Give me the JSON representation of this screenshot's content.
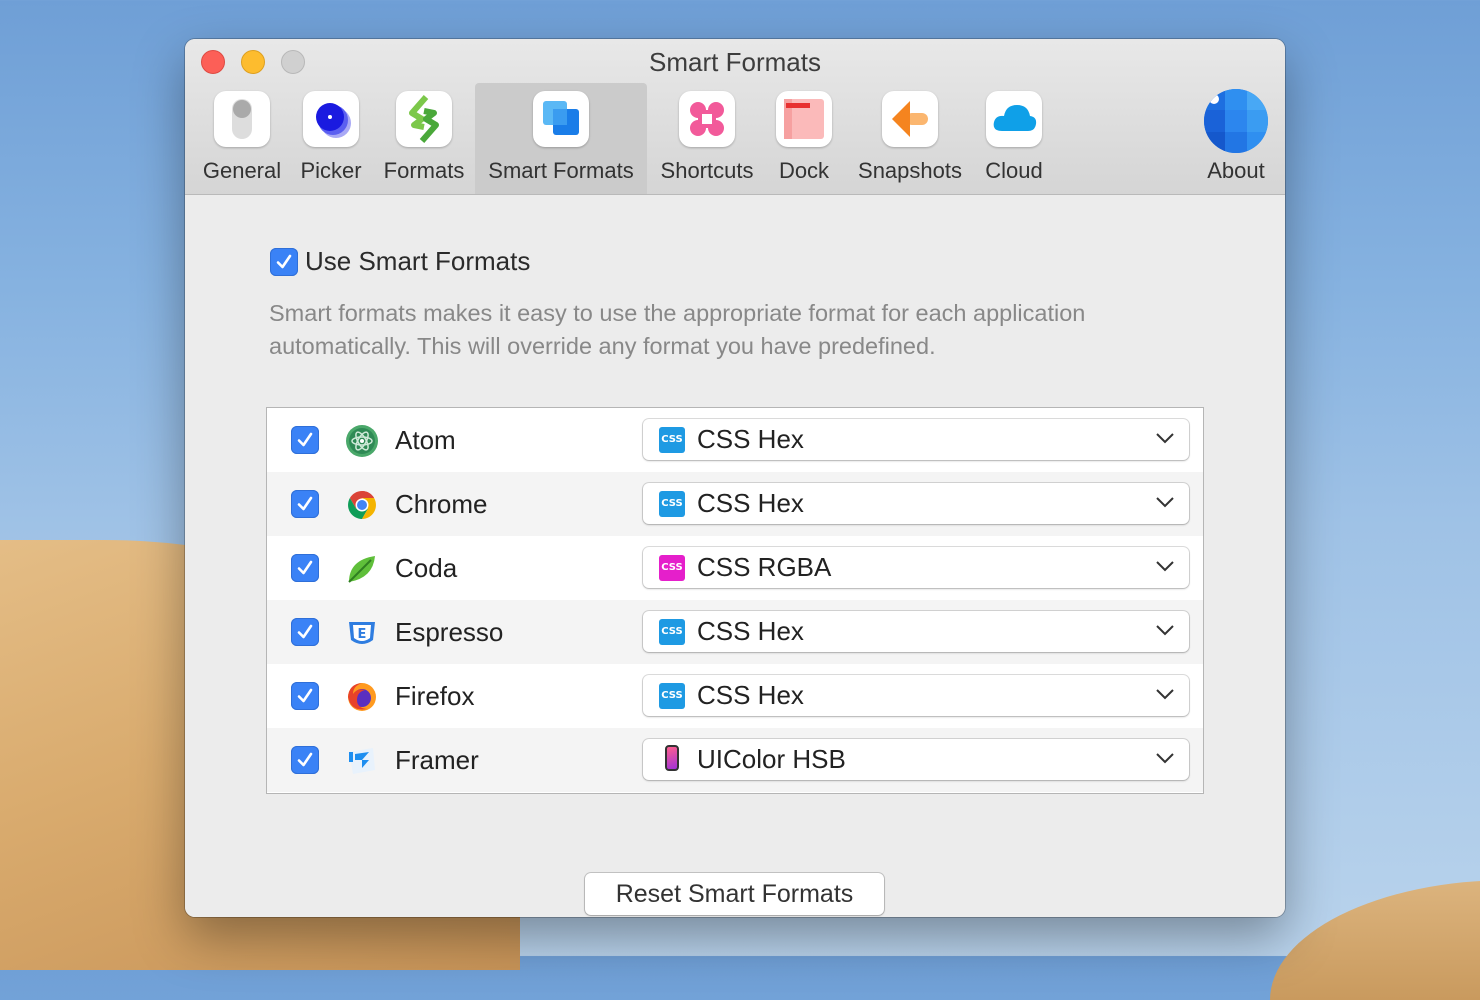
{
  "window": {
    "title": "Smart Formats"
  },
  "toolbar": {
    "tabs": [
      {
        "label": "General",
        "icon": "toggle-icon"
      },
      {
        "label": "Picker",
        "icon": "picker-icon"
      },
      {
        "label": "Formats",
        "icon": "formats-icon"
      },
      {
        "label": "Smart Formats",
        "icon": "smart-formats-icon",
        "active": true
      },
      {
        "label": "Shortcuts",
        "icon": "shortcuts-icon"
      },
      {
        "label": "Dock",
        "icon": "dock-icon"
      },
      {
        "label": "Snapshots",
        "icon": "snapshots-icon"
      },
      {
        "label": "Cloud",
        "icon": "cloud-icon"
      },
      {
        "label": "About",
        "icon": "about-icon"
      }
    ]
  },
  "main": {
    "use_smart_formats": {
      "label": "Use Smart Formats",
      "checked": true
    },
    "description": "Smart formats makes it easy to use the appropriate format for each application automatically. This will override any format you have predefined.",
    "apps": [
      {
        "name": "Atom",
        "enabled": true,
        "format": "CSS Hex",
        "format_icon": "css-icon",
        "format_color": "#1e9ae3",
        "icon": "atom-icon"
      },
      {
        "name": "Chrome",
        "enabled": true,
        "format": "CSS Hex",
        "format_icon": "css-icon",
        "format_color": "#1e9ae3",
        "icon": "chrome-icon"
      },
      {
        "name": "Coda",
        "enabled": true,
        "format": "CSS RGBA",
        "format_icon": "css-icon",
        "format_color": "#e51fcb",
        "icon": "coda-icon"
      },
      {
        "name": "Espresso",
        "enabled": true,
        "format": "CSS Hex",
        "format_icon": "css-icon",
        "format_color": "#1e9ae3",
        "icon": "espresso-icon"
      },
      {
        "name": "Firefox",
        "enabled": true,
        "format": "CSS Hex",
        "format_icon": "css-icon",
        "format_color": "#1e9ae3",
        "icon": "firefox-icon"
      },
      {
        "name": "Framer",
        "enabled": true,
        "format": "UIColor HSB",
        "format_icon": "iphone-icon",
        "icon": "framer-icon"
      }
    ],
    "css_badge": "CSS",
    "reset_label": "Reset Smart Formats"
  },
  "colors": {
    "accent": "#3a82f6",
    "css_blue": "#1e9ae3",
    "css_pink": "#e51fcb"
  }
}
